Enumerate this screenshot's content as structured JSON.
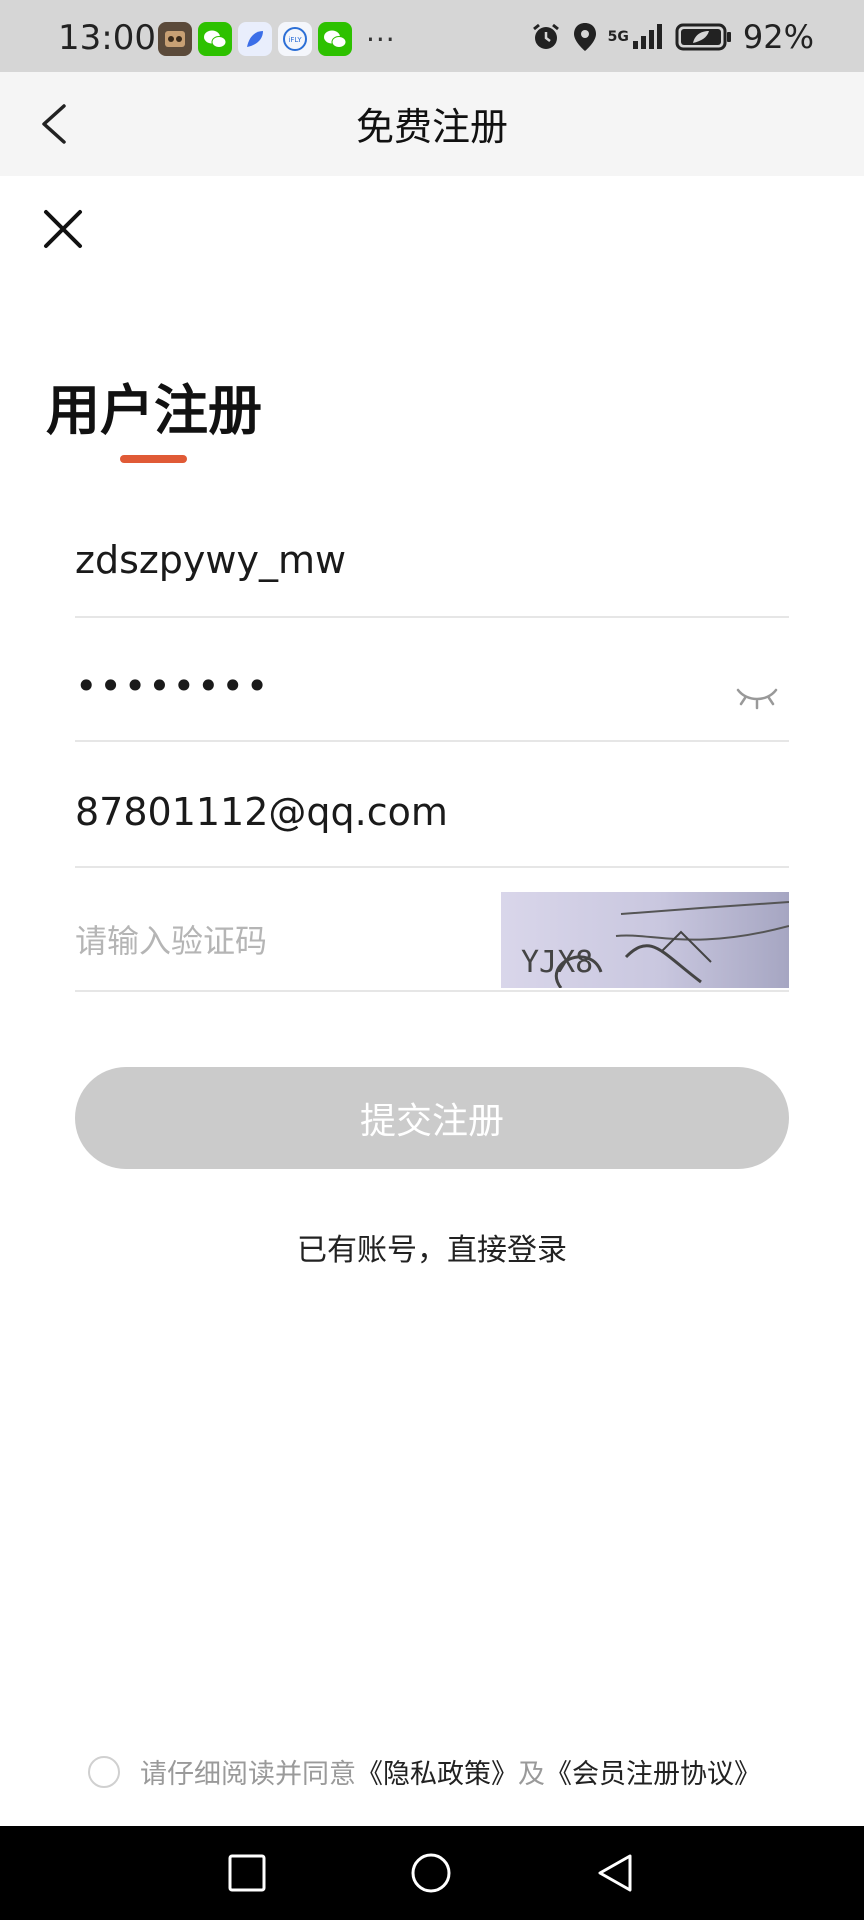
{
  "status_bar": {
    "time": "13:00",
    "battery": "92%",
    "network": "5G",
    "icons": [
      "game-app-icon",
      "wechat-icon",
      "feather-app-icon",
      "ifly-icon",
      "wechat-icon",
      "alarm-icon",
      "location-icon",
      "signal-icon",
      "battery-icon"
    ],
    "overflow": "···"
  },
  "header": {
    "title": "免费注册"
  },
  "page": {
    "title": "用户注册",
    "accent_color": "#e05a36"
  },
  "form": {
    "username_value": "zdszpywy_mw",
    "password_value": "********",
    "email_value": "87801112@qq.com",
    "captcha_placeholder": "请输入验证码",
    "captcha_text": "YJX8",
    "submit_label": "提交注册"
  },
  "login_link": "已有账号，直接登录",
  "agreement": {
    "prefix": "请仔细阅读并同意",
    "privacy": "《隐私政策》",
    "joiner": "及",
    "member": "《会员注册协议》"
  }
}
